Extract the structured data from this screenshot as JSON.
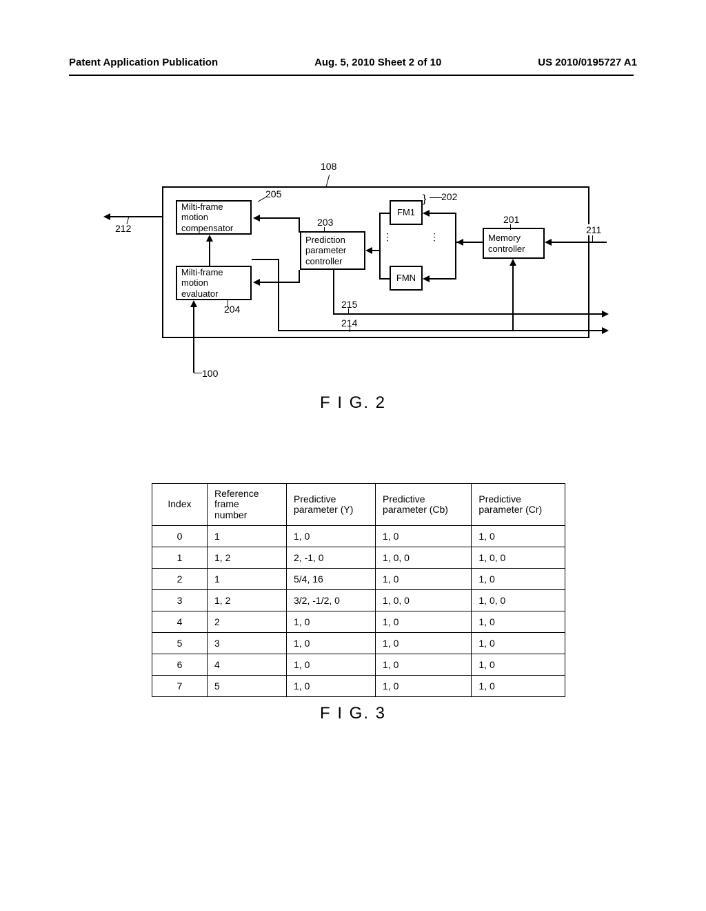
{
  "header": {
    "left": "Patent Application Publication",
    "center": "Aug. 5, 2010  Sheet 2 of 10",
    "right": "US 2010/0195727 A1"
  },
  "fig2": {
    "caption": "F I G. 2",
    "boxes": {
      "compensator": "Milti-frame\nmotion\ncompensator",
      "evaluator": "Milti-frame\nmotion\nevaluator",
      "param_ctrl": "Prediction\nparameter\ncontroller",
      "fm1": "FM1",
      "fmn": "FMN",
      "mem_ctrl": "Memory\ncontroller"
    },
    "labels": {
      "l108": "108",
      "l205": "205",
      "l212": "212",
      "l203": "203",
      "l202": "202",
      "l201": "201",
      "l211": "211",
      "l204": "204",
      "l215": "215",
      "l214": "214",
      "l100": "100",
      "curly": "}"
    }
  },
  "fig3": {
    "caption": "F I G. 3",
    "columns": [
      "Index",
      "Reference frame\nnumber",
      "Predictive\nparameter (Y)",
      "Predictive\nparameter (Cb)",
      "Predictive\nparameter (Cr)"
    ],
    "rows": [
      [
        "0",
        "1",
        "1, 0",
        "1, 0",
        "1, 0"
      ],
      [
        "1",
        "1, 2",
        "2, -1, 0",
        "1, 0, 0",
        "1, 0, 0"
      ],
      [
        "2",
        "1",
        "5/4, 16",
        "1, 0",
        "1, 0"
      ],
      [
        "3",
        "1, 2",
        "3/2, -1/2, 0",
        "1, 0, 0",
        "1, 0, 0"
      ],
      [
        "4",
        "2",
        "1, 0",
        "1, 0",
        "1, 0"
      ],
      [
        "5",
        "3",
        "1, 0",
        "1, 0",
        "1, 0"
      ],
      [
        "6",
        "4",
        "1, 0",
        "1, 0",
        "1, 0"
      ],
      [
        "7",
        "5",
        "1, 0",
        "1, 0",
        "1, 0"
      ]
    ]
  }
}
